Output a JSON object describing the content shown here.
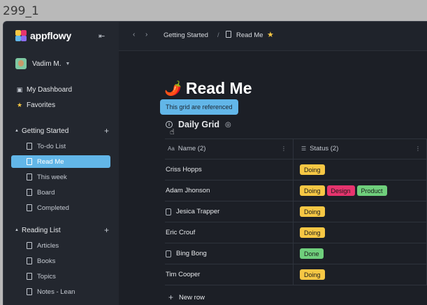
{
  "outer_label": "299_1",
  "app": {
    "logo_text": "appflowy"
  },
  "user": {
    "name": "Vadim M."
  },
  "sidebar": {
    "top_items": [
      {
        "label": "My Dashboard",
        "icon": "dashboard-icon"
      },
      {
        "label": "Favorites",
        "icon": "star-icon"
      }
    ],
    "sections": [
      {
        "label": "Getting Started",
        "pages": [
          "To-do List",
          "Read Me",
          "This week",
          "Board",
          "Completed"
        ]
      },
      {
        "label": "Reading List",
        "pages": [
          "Articles",
          "Books",
          "Topics",
          "Notes - Lean"
        ]
      }
    ],
    "active_page": "Read Me"
  },
  "breadcrumb": {
    "parent": "Getting Started",
    "current": "Read Me",
    "separator": "/"
  },
  "page": {
    "emoji": "🌶️",
    "title": "Read Me",
    "tooltip": "This grid are referenced",
    "grid_title": "Daily Grid"
  },
  "grid": {
    "columns": [
      {
        "label": "Name (2)",
        "icon": "Aa"
      },
      {
        "label": "Status (2)",
        "icon": "☰"
      }
    ],
    "rows": [
      {
        "name": "Criss Hopps",
        "has_doc": false,
        "tags": [
          "Doing"
        ]
      },
      {
        "name": "Adam Jhonson",
        "has_doc": false,
        "tags": [
          "Doing",
          "Design",
          "Product"
        ]
      },
      {
        "name": "Jesica Trapper",
        "has_doc": true,
        "tags": [
          "Doing"
        ]
      },
      {
        "name": "Eric Crouf",
        "has_doc": false,
        "tags": [
          "Doing"
        ]
      },
      {
        "name": "Bing Bong",
        "has_doc": true,
        "tags": [
          "Done"
        ]
      },
      {
        "name": "Tim Cooper",
        "has_doc": false,
        "tags": [
          "Doing"
        ]
      }
    ],
    "new_row_label": "New row"
  },
  "tag_colors": {
    "Doing": "#f6c744",
    "Design": "#e6346e",
    "Product": "#6fcf7c",
    "Done": "#6fcf7c"
  },
  "colors": {
    "accent": "#62b6e8",
    "sidebar_bg": "#23272f",
    "main_bg": "#1c1f26"
  }
}
